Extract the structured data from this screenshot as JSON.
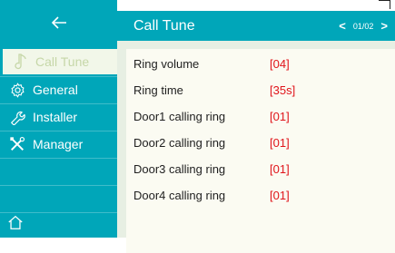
{
  "sidebar": {
    "back_icon": "arrow-left-icon",
    "items": [
      {
        "label": "Call Tune",
        "icon": "music-note-icon"
      },
      {
        "label": "General",
        "icon": "gear-icon"
      },
      {
        "label": "Installer",
        "icon": "wrench-icon"
      },
      {
        "label": "Manager",
        "icon": "tools-icon"
      }
    ],
    "home_icon": "home-icon"
  },
  "header": {
    "title": "Call Tune",
    "page": "01/02",
    "prev": "<",
    "next": ">"
  },
  "settings": [
    {
      "label": "Ring volume",
      "value": "[04]"
    },
    {
      "label": "Ring time",
      "value": "[35s]"
    },
    {
      "label": "Door1 calling ring",
      "value": "[01]"
    },
    {
      "label": "Door2 calling ring",
      "value": "[01]"
    },
    {
      "label": "Door3 calling ring",
      "value": "[01]"
    },
    {
      "label": "Door4 calling ring",
      "value": "[01]"
    }
  ],
  "colors": {
    "accent": "#00a6b9",
    "value_red": "#e0141a",
    "panel": "#fbfbf2",
    "active_item_bg": "#f2f7e9"
  }
}
